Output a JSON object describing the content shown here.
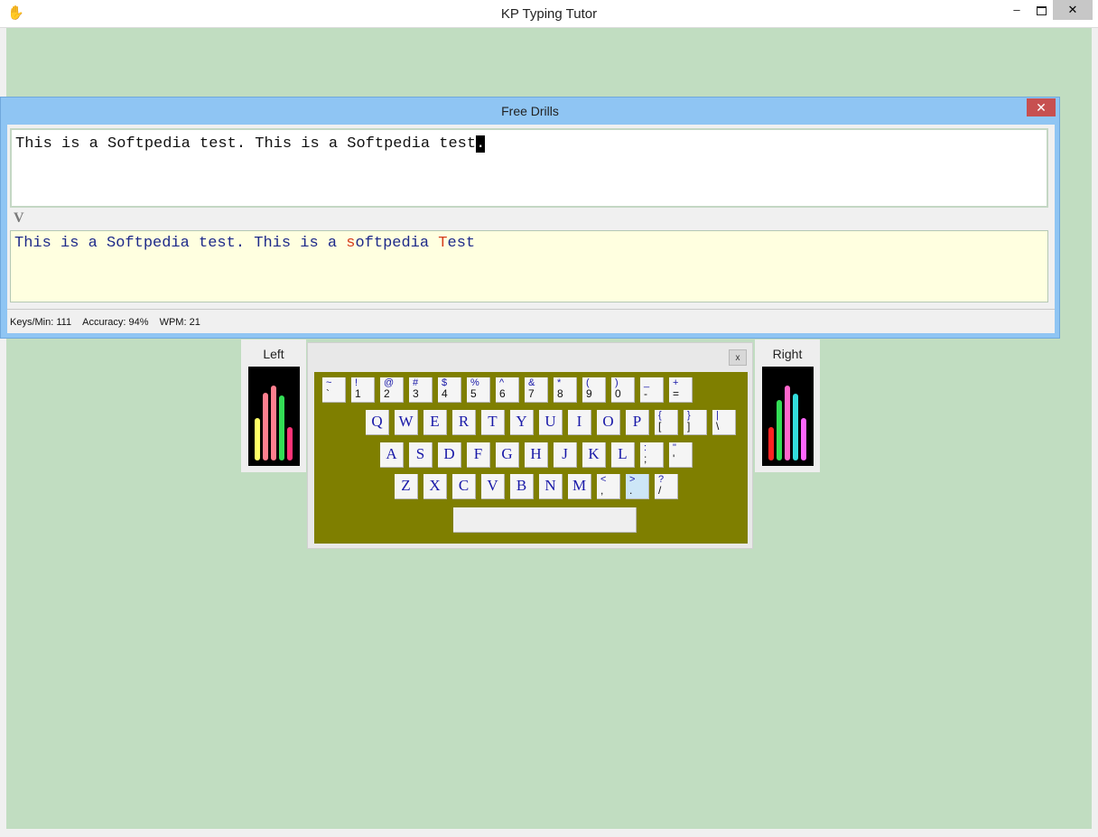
{
  "window": {
    "title": "KP Typing Tutor",
    "minimize": "–",
    "close": "✕"
  },
  "drills": {
    "title": "Free Drills",
    "close": "✕",
    "target_text": "This is a Softpedia test. This is a Softpedia test",
    "cursor_char": ".",
    "marker": "V",
    "typed": {
      "part1": "This is a Softpedia test. This is a ",
      "err1": "s",
      "part2": "oftpedia ",
      "err2": "T",
      "part3": "est"
    }
  },
  "status": {
    "keys_per_min": "Keys/Min: 111",
    "accuracy": "Accuracy: 94%",
    "wpm": "WPM: 21"
  },
  "hands": {
    "left_label": "Left",
    "right_label": "Right",
    "left_bars": [
      {
        "color": "#ffff66",
        "level": 0.48
      },
      {
        "color": "#ff7f8f",
        "level": 0.77
      },
      {
        "color": "#ff7f8f",
        "level": 0.85
      },
      {
        "color": "#33dd55",
        "level": 0.73
      },
      {
        "color": "#ff3377",
        "level": 0.38
      }
    ],
    "right_bars": [
      {
        "color": "#ff2222",
        "level": 0.38
      },
      {
        "color": "#33dd55",
        "level": 0.68
      },
      {
        "color": "#ff66cc",
        "level": 0.85
      },
      {
        "color": "#33dddd",
        "level": 0.75
      },
      {
        "color": "#ff66ff",
        "level": 0.48
      }
    ]
  },
  "keyboard": {
    "close": "x",
    "number_row": [
      {
        "shift": "~",
        "base": "`"
      },
      {
        "shift": "!",
        "base": "1"
      },
      {
        "shift": "@",
        "base": "2"
      },
      {
        "shift": "#",
        "base": "3"
      },
      {
        "shift": "$",
        "base": "4"
      },
      {
        "shift": "%",
        "base": "5"
      },
      {
        "shift": "^",
        "base": "6"
      },
      {
        "shift": "&",
        "base": "7"
      },
      {
        "shift": "*",
        "base": "8"
      },
      {
        "shift": "(",
        "base": "9"
      },
      {
        "shift": ")",
        "base": "0"
      },
      {
        "shift": "_",
        "base": "-"
      },
      {
        "shift": "+",
        "base": "="
      }
    ],
    "row_q": [
      "Q",
      "W",
      "E",
      "R",
      "T",
      "Y",
      "U",
      "I",
      "O",
      "P"
    ],
    "row_q_sym": [
      {
        "shift": "{",
        "base": "["
      },
      {
        "shift": "}",
        "base": "]"
      },
      {
        "shift": "|",
        "base": "\\"
      }
    ],
    "row_a": [
      "A",
      "S",
      "D",
      "F",
      "G",
      "H",
      "J",
      "K",
      "L"
    ],
    "row_a_sym": [
      {
        "shift": ":",
        "base": ";"
      },
      {
        "shift": "\"",
        "base": "'"
      }
    ],
    "row_z": [
      "Z",
      "X",
      "C",
      "V",
      "B",
      "N",
      "M"
    ],
    "row_z_sym": [
      {
        "shift": "<",
        "base": ","
      },
      {
        "shift": ">",
        "base": "."
      },
      {
        "shift": "?",
        "base": "/"
      }
    ],
    "highlighted_key": "."
  }
}
